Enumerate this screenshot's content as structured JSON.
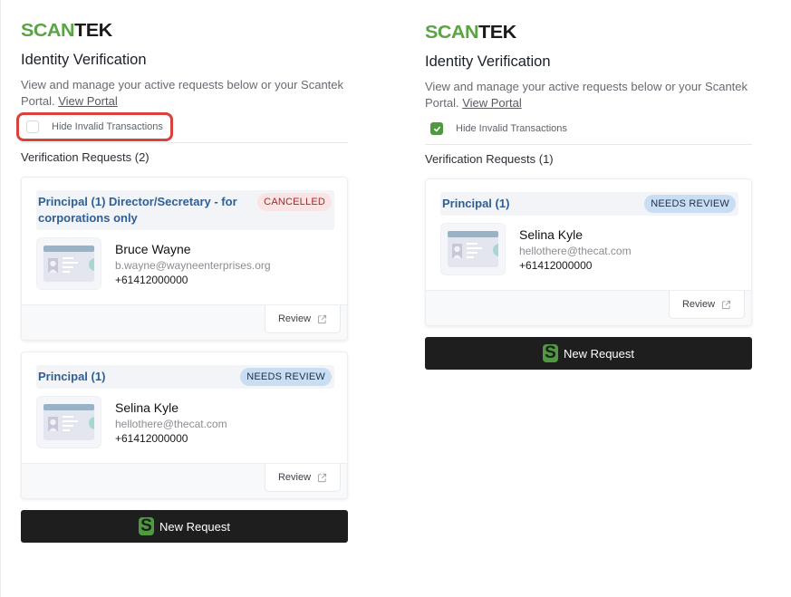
{
  "brand": {
    "logo_part1": "SCAN",
    "logo_part2": "TEK",
    "accent": "#5aa445"
  },
  "panels": [
    {
      "title": "Identity Verification",
      "description": "View and manage your active requests below or your Scantek Portal.",
      "portal_link": "View Portal",
      "filter": {
        "label": "Hide Invalid Transactions",
        "checked": false,
        "highlighted": true
      },
      "section_label": "Verification Requests (2)",
      "requests": [
        {
          "role": "Principal (1) Director/Secretary - for corporations only",
          "status": "CANCELLED",
          "name": "Bruce Wayne",
          "email": "b.wayne@wayneenterprises.org",
          "phone": "+61412000000",
          "action": "Review"
        },
        {
          "role": "Principal (1)",
          "status": "NEEDS REVIEW",
          "name": "Selina Kyle",
          "email": "hellothere@thecat.com",
          "phone": "+61412000000",
          "action": "Review"
        }
      ],
      "new_request": "New Request"
    },
    {
      "title": "Identity Verification",
      "description": "View and manage your active requests below or your Scantek Portal.",
      "portal_link": "View Portal",
      "filter": {
        "label": "Hide Invalid Transactions",
        "checked": true,
        "highlighted": false
      },
      "section_label": "Verification Requests (1)",
      "requests": [
        {
          "role": "Principal (1)",
          "status": "NEEDS REVIEW",
          "name": "Selina Kyle",
          "email": "hellothere@thecat.com",
          "phone": "+61412000000",
          "action": "Review"
        }
      ],
      "new_request": "New Request"
    }
  ],
  "icons": {
    "external_link": "external-link-icon",
    "id_card": "id-card-icon",
    "check": "check-icon",
    "scantek_s": "S"
  },
  "colors": {
    "cancelled_bg": "#fbe4e4",
    "cancelled_text": "#9c2b2b",
    "review_bg": "#c9def3",
    "review_text": "#1d2f48",
    "highlight": "#d9423a",
    "button_dark": "#1e1e1e"
  }
}
